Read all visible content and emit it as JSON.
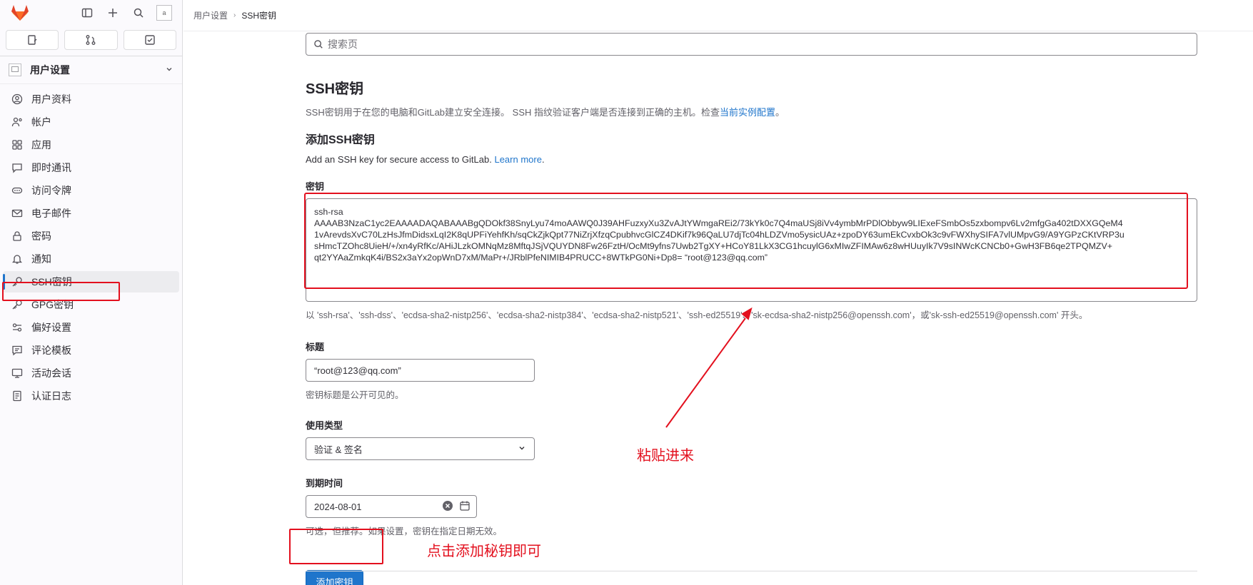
{
  "sidebar": {
    "context_title": "用户设置",
    "items": [
      {
        "label": "用户资料",
        "icon": "profile-icon"
      },
      {
        "label": "帐户",
        "icon": "account-icon"
      },
      {
        "label": "应用",
        "icon": "applications-icon"
      },
      {
        "label": "即时通讯",
        "icon": "chat-icon"
      },
      {
        "label": "访问令牌",
        "icon": "token-icon"
      },
      {
        "label": "电子邮件",
        "icon": "mail-icon"
      },
      {
        "label": "密码",
        "icon": "lock-icon"
      },
      {
        "label": "通知",
        "icon": "bell-icon"
      },
      {
        "label": "SSH密钥",
        "icon": "key-icon",
        "active": true
      },
      {
        "label": "GPG密钥",
        "icon": "key-icon"
      },
      {
        "label": "偏好设置",
        "icon": "preferences-icon"
      },
      {
        "label": "评论模板",
        "icon": "comment-template-icon"
      },
      {
        "label": "活动会话",
        "icon": "sessions-icon"
      },
      {
        "label": "认证日志",
        "icon": "log-icon"
      }
    ]
  },
  "breadcrumb": {
    "parent": "用户设置",
    "current": "SSH密钥"
  },
  "search": {
    "placeholder": "搜索页"
  },
  "page": {
    "title": "SSH密钥",
    "description": "SSH密钥用于在您的电脑和GitLab建立安全连接。 SSH 指纹验证客户端是否连接到正确的主机。检查",
    "description_link": "当前实例配置",
    "description_end": "。",
    "add_title": "添加SSH密钥",
    "add_subtitle": "Add an SSH key for secure access to GitLab. ",
    "learn_more": "Learn more",
    "learn_more_end": "."
  },
  "form": {
    "key_label": "密钥",
    "key_lines": [
      "ssh-rsa",
      "AAAAB3NzaC1yc2EAAAADAQABAAABgQDOkf38SnyLyu74moAAWQ0J39AHFuzxyXu3ZvAJtYWmgaREi2/73kYk0c7Q4maUSj8iVv4ymbMrPDlObbyw9LIExeFSmbOs5zxbompv6Lv2mfgGa402tDXXGQeM4",
      "1vArevdsXvC70LzHsJfmDidsxLqI2K8qUPFiYehfKh/sqCkZjkQpt77NiZrjXfzqCpubhvcGlCZ4DKif7k96QaLU7djTc04hLDZVmo5ysicUAz+zpoDY63umEkCvxbOk3c9vFWXhySIFA7vlUMpvG9/A9YGPzCKtVRP3u",
      "sHmcTZOhc8UieH/+/xn4yRfKc/AHiJLzkOMNqMz8MftqJSjVQUYDN8Fw26FztH/OcMt9yfns7Uwb2TgXY+HCoY81LkX3CG1hcuylG6xMIwZFIMAw6z8wHUuyIk7V9sINWcKCNCb0+GwH3FB6qe2TPQMZV+",
      "qt2YYAaZmkqK4i/BS2x3aYx2opWnD7xM/MaPr+/JRblPfeNIMIB4PRUCC+8WTkPG0Ni+Dp8= “root@123@qq.com”"
    ],
    "key_help": "以 'ssh-rsa'、'ssh-dss'、'ecdsa-sha2-nistp256'、'ecdsa-sha2-nistp384'、'ecdsa-sha2-nistp521'、'ssh-ed25519'、'sk-ecdsa-sha2-nistp256@openssh.com'，或'sk-ssh-ed25519@openssh.com' 开头。",
    "title_label": "标题",
    "title_value": "“root@123@qq.com”",
    "title_help": "密钥标题是公开可见的。",
    "type_label": "使用类型",
    "type_value": "验证 & 签名",
    "expiry_label": "到期时间",
    "expiry_value": "2024-08-01",
    "expiry_help": "可选，但推荐。如果设置，密钥在指定日期无效。",
    "submit_label": "添加密钥"
  },
  "annotations": {
    "paste": "粘贴进来",
    "click": "点击添加秘钥即可",
    "color": "#e3101e"
  }
}
